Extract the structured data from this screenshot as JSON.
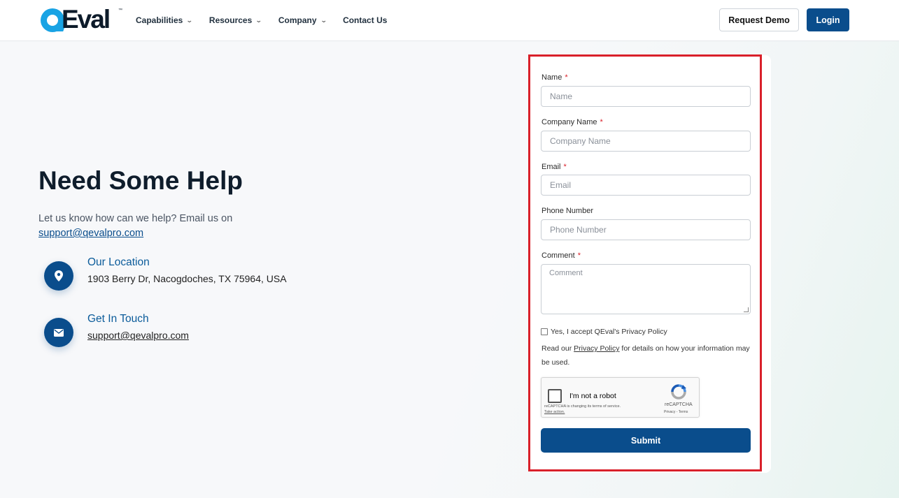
{
  "brand": {
    "logo_text": "Eval",
    "logo_letter": "Q",
    "trademark": "™"
  },
  "nav": {
    "items": [
      {
        "label": "Capabilities",
        "has_dropdown": true
      },
      {
        "label": "Resources",
        "has_dropdown": true
      },
      {
        "label": "Company",
        "has_dropdown": true
      },
      {
        "label": "Contact Us",
        "has_dropdown": false
      }
    ],
    "request_demo": "Request Demo",
    "login": "Login"
  },
  "help": {
    "title": "Need Some Help",
    "text": "Let us know how can we help? Email us on",
    "email": "support@qevalpro.com"
  },
  "contact": {
    "location_title": "Our Location",
    "location_text": "1903 Berry Dr, Nacogdoches, TX 75964, USA",
    "touch_title": "Get In Touch",
    "touch_text": "support@qevalpro.com"
  },
  "form": {
    "name_label": "Name",
    "name_placeholder": "Name",
    "company_label": "Company Name",
    "company_placeholder": "Company Name",
    "email_label": "Email",
    "email_placeholder": "Email",
    "phone_label": "Phone Number",
    "phone_placeholder": "Phone Number",
    "comment_label": "Comment",
    "comment_placeholder": "Comment",
    "required_mark": "*",
    "privacy_accept": "Yes, I accept QEval's Privacy Policy",
    "privacy_note_prefix": "Read our ",
    "privacy_note_link": "Privacy Policy",
    "privacy_note_suffix": " for details on how your information may be used.",
    "submit": "Submit"
  },
  "recaptcha": {
    "label": "I'm not a robot",
    "note": "reCAPTCHA is changing its terms of service.",
    "action": "Take action.",
    "brand": "reCAPTCHA",
    "terms": "Privacy - Terms"
  },
  "colors": {
    "primary": "#0a4d8c",
    "accent": "#19a3e4",
    "highlight": "#d9202a"
  },
  "icons": [
    "location-pin-icon",
    "mail-icon",
    "chevron-down-icon",
    "recaptcha-icon"
  ]
}
